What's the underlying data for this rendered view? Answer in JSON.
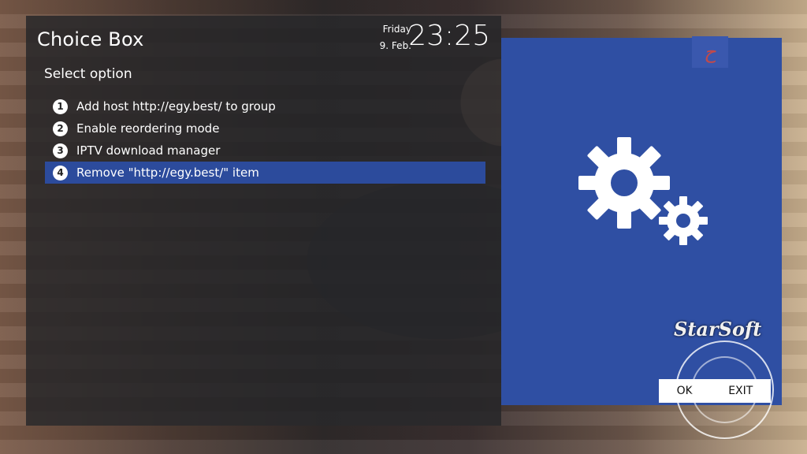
{
  "header": {
    "title": "Choice Box",
    "day": "Friday",
    "date": "9. Feb.",
    "time": "23:25"
  },
  "subtitle": "Select option",
  "menu": {
    "items": [
      {
        "number": "1",
        "label": "Add host http://egy.best/ to group"
      },
      {
        "number": "2",
        "label": "Enable reordering mode"
      },
      {
        "number": "3",
        "label": "IPTV download manager"
      },
      {
        "number": "4",
        "label": "Remove \"http://egy.best/\" item",
        "selected": true
      }
    ]
  },
  "buttons": {
    "ok": "OK",
    "exit": "EXIT"
  },
  "watermark": {
    "brand": "StarSoft"
  },
  "colors": {
    "panel": "#262628",
    "accent": "#2f4fa3",
    "selected": "#2c4b9c"
  },
  "icons": [
    "gears-icon",
    "logo-icon"
  ]
}
